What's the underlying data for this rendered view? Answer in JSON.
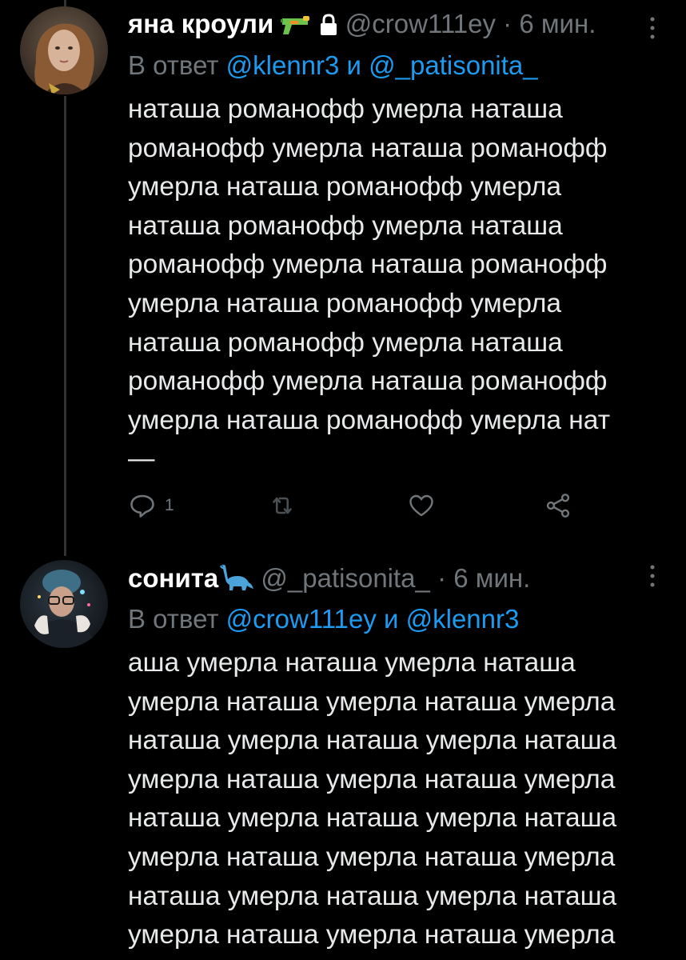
{
  "colors": {
    "background": "#000000",
    "text": "#e7e9ea",
    "muted": "#71767b",
    "mention": "#1d9bf0",
    "thread_line": "#2f3336"
  },
  "tweets": [
    {
      "name": "яна кроули",
      "name_emojis": [
        "water-pistol-icon",
        "lock-icon"
      ],
      "handle": "@crow111ey",
      "separator": "·",
      "time": "6 мин.",
      "reply_prefix": "В ответ",
      "reply_mention_1": "@klennr3",
      "reply_joiner": "и",
      "reply_mention_2": "@_patisonita_",
      "text_lines": [
        "наташа романофф умерла наташа",
        "романофф умерла наташа романофф",
        "умерла наташа романофф умерла",
        "наташа романофф умерла наташа",
        "романофф умерла наташа романофф",
        "умерла наташа романофф умерла",
        "наташа романофф умерла наташа",
        "романофф умерла наташа романофф",
        "умерла наташа романофф умерла нат",
        "—"
      ],
      "actions": {
        "reply_count": "1",
        "retweet_count": "",
        "like_count": ""
      }
    },
    {
      "name": "сонита",
      "name_emojis": [
        "sauropod-icon"
      ],
      "handle": "@_patisonita_",
      "separator": "·",
      "time": "6 мин.",
      "reply_prefix": "В ответ",
      "reply_mention_1": "@crow111ey",
      "reply_joiner": "и",
      "reply_mention_2": "@klennr3",
      "text_lines": [
        "аша умерла наташа умерла наташа",
        "умерла наташа умерла наташа умерла",
        "наташа умерла наташа умерла наташа",
        "умерла наташа умерла наташа умерла",
        "наташа умерла наташа умерла наташа",
        "умерла наташа умерла наташа умерла",
        "наташа умерла наташа умерла наташа",
        "умерла наташа умерла наташа умерла"
      ]
    }
  ]
}
